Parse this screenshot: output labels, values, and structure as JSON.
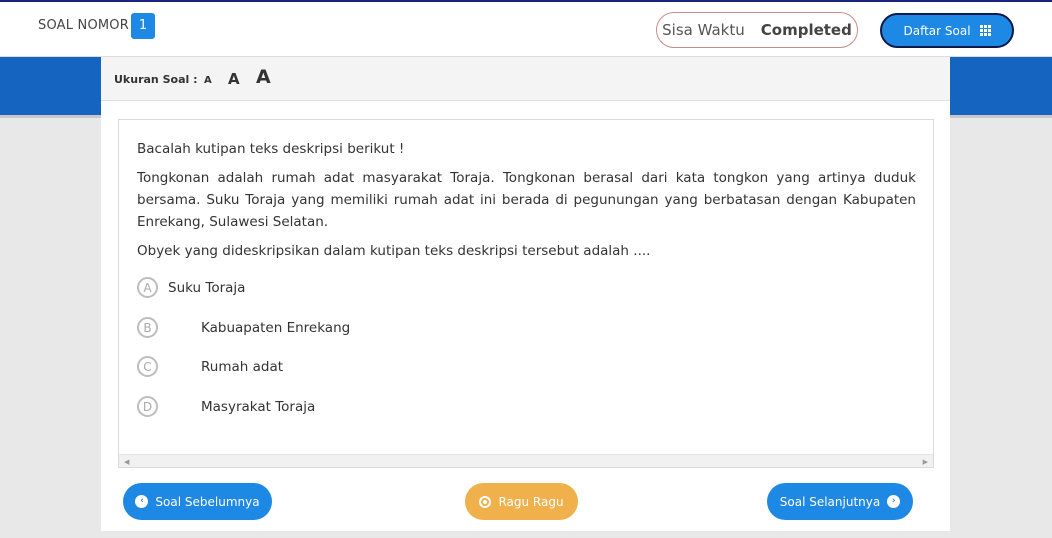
{
  "header": {
    "soal_label": "SOAL NOMOR",
    "soal_number": "1",
    "timer_label": "Sisa Waktu",
    "timer_value": "Completed",
    "daftar_label": "Daftar Soal"
  },
  "font_size": {
    "title": "Ukuran Soal :",
    "small": "A",
    "medium": "A",
    "large": "A"
  },
  "question": {
    "intro": "Bacalah kutipan teks deskripsi berikut !",
    "passage": "Tongkonan adalah rumah adat masyarakat Toraja. Tongkonan berasal dari kata tongkon yang artinya duduk bersama. Suku Toraja yang memiliki rumah adat ini berada di pegunungan yang berbatasan dengan Kabupaten Enrekang, Sulawesi Selatan.",
    "prompt": "Obyek yang dideskripsikan dalam kutipan teks deskripsi tersebut adalah ...."
  },
  "options": [
    {
      "letter": "A",
      "text": "Suku Toraja"
    },
    {
      "letter": "B",
      "text": "Kabuapaten Enrekang"
    },
    {
      "letter": "C",
      "text": "Rumah adat"
    },
    {
      "letter": "D",
      "text": "Masyrakat Toraja"
    }
  ],
  "nav": {
    "prev_label": "Soal Sebelumnya",
    "ragu_label": "Ragu Ragu",
    "next_label": "Soal Selanjutnya"
  },
  "colors": {
    "primary": "#1e88e5",
    "band": "#1565c0",
    "warning": "#f0b04c"
  },
  "icons": {
    "daftar": "grid-icon",
    "prev": "chevron-left-circle-icon",
    "ragu": "dot-circle-icon",
    "next": "chevron-right-circle-icon"
  }
}
